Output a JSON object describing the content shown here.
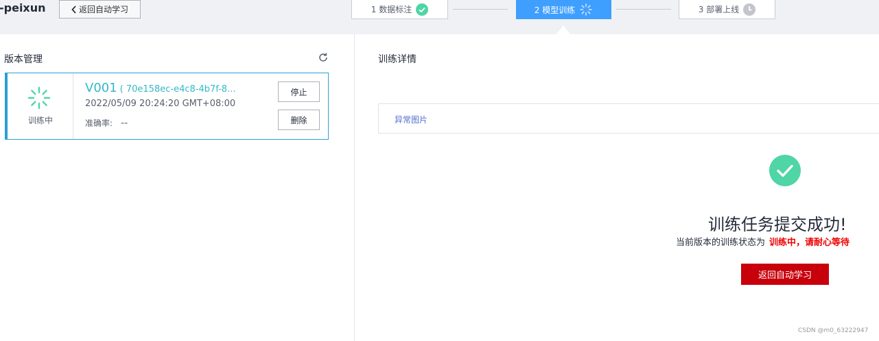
{
  "header": {
    "project_name": "-peixun",
    "back_label": "返回自动学习",
    "steps": [
      {
        "label": "1 数据标注",
        "state": "done"
      },
      {
        "label": "2 模型训练",
        "state": "active"
      },
      {
        "label": "3 部署上线",
        "state": "pending"
      }
    ]
  },
  "left": {
    "title": "版本管理",
    "version": {
      "status": "训练中",
      "name": "V001",
      "id": "( 70e158ec-e4c8-4b7f-8...",
      "time": "2022/05/09 20:24:20 GMT+08:00",
      "accuracy_label": "准确率:",
      "accuracy_value": "--",
      "stop_label": "停止",
      "delete_label": "删除"
    }
  },
  "right": {
    "title": "训练详情",
    "tab_label": "异常图片",
    "success_title": "训练任务提交成功!",
    "success_desc": "当前版本的训练状态为",
    "success_status": "训练中，请耐心等待",
    "return_label": "返回自动学习"
  },
  "watermark": "CSDN @m0_63222947",
  "colors": {
    "accent": "#3f9fff",
    "teal": "#33b8c8",
    "success": "#4fd5a6",
    "danger_button": "#c7000b",
    "danger_text": "#ee0000"
  }
}
